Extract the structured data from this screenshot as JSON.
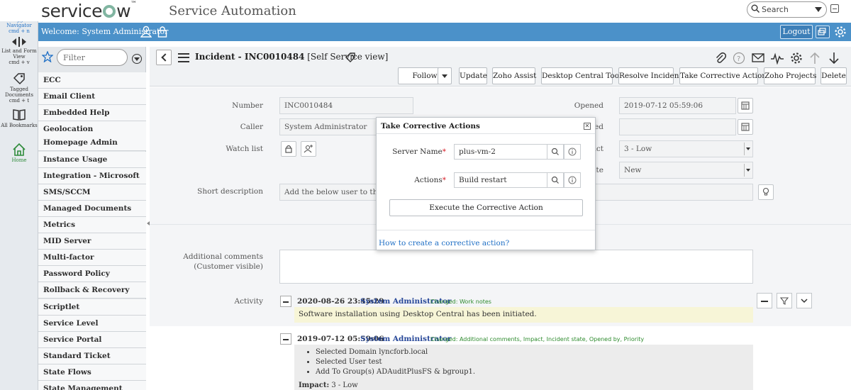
{
  "header": {
    "brand": "servicenow",
    "product": "Service Automation",
    "search_placeholder": "Search"
  },
  "rail": {
    "items": [
      {
        "label": "Toggle Navigator",
        "shortcut": "cmd + n"
      },
      {
        "label": "List and Form View",
        "shortcut": "cmd + v"
      },
      {
        "label": "Tagged Documents",
        "shortcut": "cmd + t"
      },
      {
        "label": "All Bookmarks"
      },
      {
        "label": "Home"
      }
    ]
  },
  "bluebar": {
    "welcome": "Welcome:  System Administrator",
    "logout": "Logout"
  },
  "navigator": {
    "filter_placeholder": "Filter",
    "items": [
      "ECC",
      "Email Client",
      "Embedded Help",
      "Geolocation",
      "Homepage Admin",
      "Instance Usage",
      "Integration - Microsoft",
      "SMS/SCCM",
      "Managed Documents",
      "Metrics",
      "MID Server",
      "Multi-factor Authentication",
      "Password Policy",
      "Rollback & Recovery",
      "Scriptlet",
      "Service Level Management",
      "Service Portal",
      "Standard Ticket",
      "State Flows",
      "State Management"
    ]
  },
  "form": {
    "title_bold": "Incident - INC0010484",
    "title_rest": " [Self Service view]",
    "buttons": [
      "Follow",
      "Update",
      "Zoho Assist",
      "Desktop Central Tools",
      "Resolve Incident",
      "Take Corrective Actions",
      "Zoho Projects",
      "Delete"
    ],
    "fields": {
      "number_label": "Number",
      "number_value": "INC0010484",
      "caller_label": "Caller",
      "caller_value": "System Administrator",
      "watch_label": "Watch list",
      "short_desc_label": "Short description",
      "short_desc_value": "Add the below user to the mentio",
      "opened_label": "Opened",
      "opened_value": "2019-07-12 05:59:06",
      "impact_label_partial": "act",
      "impact_value": "3 - Low",
      "state_label_partial": "ate",
      "state_value": "New",
      "closed_label_partial": "ed",
      "comments_label": "Additional comments (Customer visible)",
      "activity_label": "Activity"
    },
    "activity": [
      {
        "time": "2020-08-26 23:45:29",
        "user": "System Administrator",
        "changed": "Changed:   Work notes",
        "note": "Software installation using Desktop Central has been initiated."
      },
      {
        "time": "2019-07-12 05:59:06",
        "user": "System Administrator",
        "changed": "Changed:   Additional comments, Impact, Incident state, Opened by, Priority",
        "bullets": [
          "Selected Domain lyncforb.local",
          "Selected User test",
          "Add To Group(s) ADAuditPlusFS & bgroup1."
        ],
        "impact_label": "Impact:",
        "impact_value": "3 - Low"
      }
    ]
  },
  "modal": {
    "title": "Take Corrective Actions",
    "server_label": "Server Name",
    "server_value": "plus-vm-2",
    "actions_label": "Actions",
    "actions_value": "Build restart",
    "required_mark": "*",
    "execute_button": "Execute the Corrective Action",
    "help_link": "How to create a corrective action?"
  },
  "colors": {
    "blue_bar": "#4b91c9",
    "link": "#1f6fc5",
    "required": "#d9202a",
    "changed_green": "#2e8b2e",
    "note_yellow": "#f7f5d7"
  }
}
